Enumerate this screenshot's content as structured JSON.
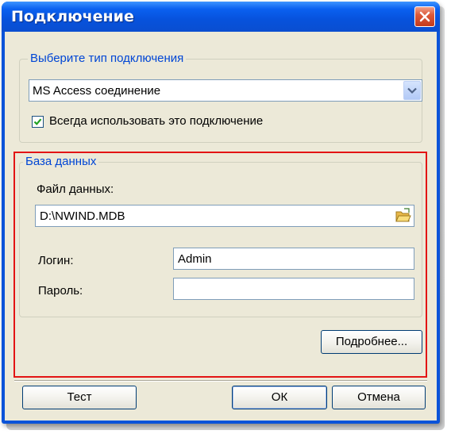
{
  "window": {
    "title": "Подключение"
  },
  "connection_group": {
    "legend": "Выберите тип подключения",
    "type_select": {
      "value": "MS Access соединение"
    },
    "always_use": {
      "label": "Всегда использовать это подключение",
      "checked": true
    }
  },
  "database_group": {
    "legend": "База данных",
    "file_label": "Файл данных:",
    "file_value": "D:\\NWIND.MDB",
    "login_label": "Логин:",
    "login_value": "Admin",
    "password_label": "Пароль:",
    "password_value": "",
    "details_button": "Подробнее..."
  },
  "footer": {
    "test_button": "Тест",
    "ok_button": "ОК",
    "cancel_button": "Отмена"
  },
  "colors": {
    "title_bar": "#0a53d9",
    "legend_text": "#0046d5",
    "highlight_border": "#e31414",
    "dialog_bg": "#ece9d8"
  }
}
